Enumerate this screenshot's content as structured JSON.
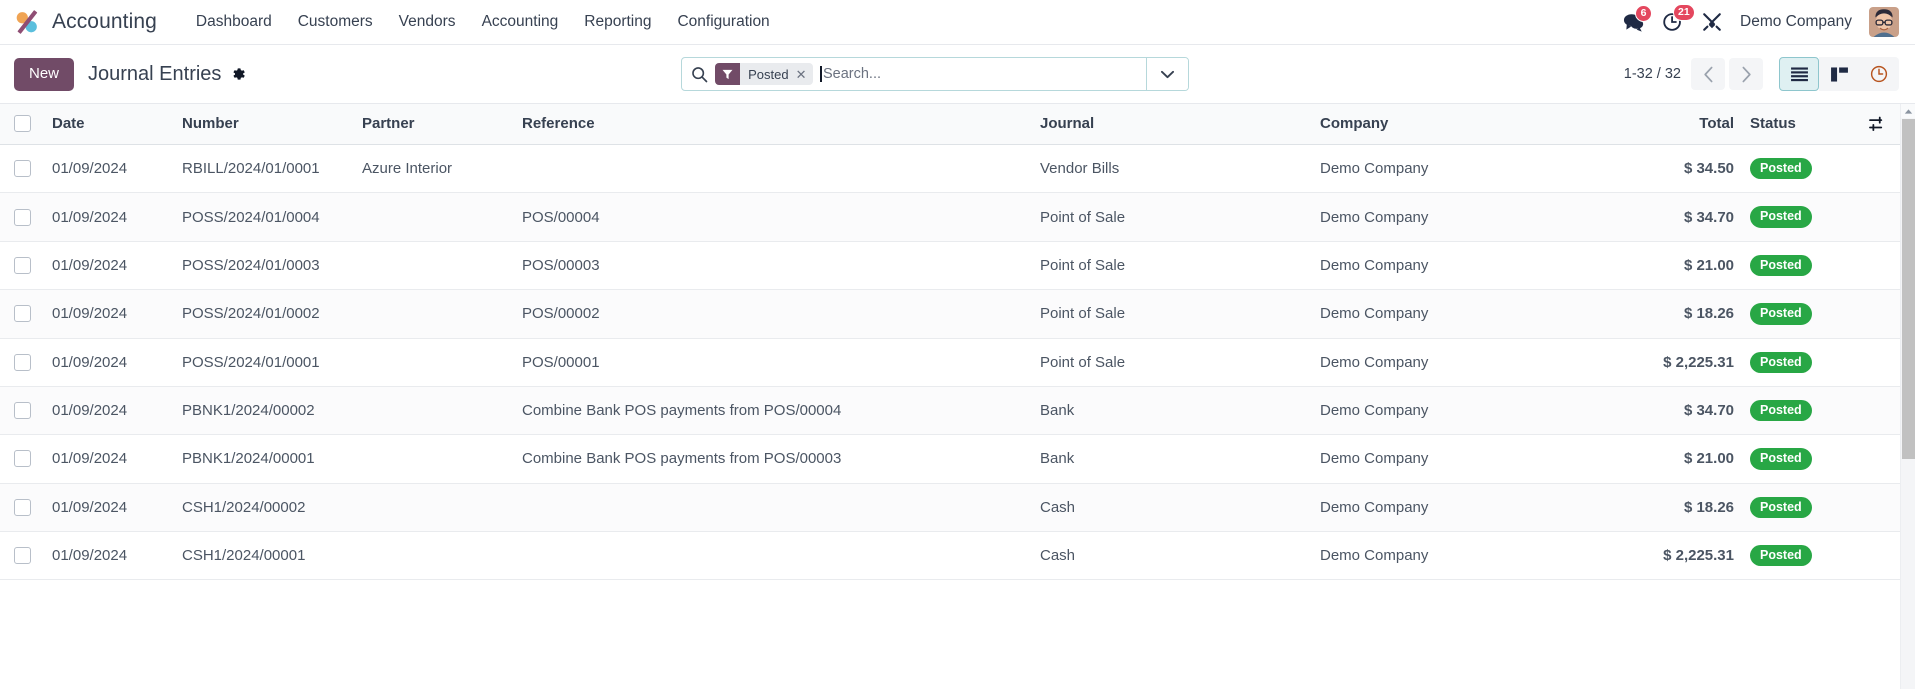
{
  "navbar": {
    "logo_icon": "odoo-logo-icon",
    "app_name": "Accounting",
    "menu": [
      {
        "label": "Dashboard"
      },
      {
        "label": "Customers"
      },
      {
        "label": "Vendors"
      },
      {
        "label": "Accounting"
      },
      {
        "label": "Reporting"
      },
      {
        "label": "Configuration"
      }
    ],
    "systray": {
      "messages_icon": "chat-bubbles-icon",
      "messages_count": "6",
      "activities_icon": "clock-icon",
      "activities_count": "21",
      "debug_icon": "wrench-screwdriver-icon",
      "company": "Demo Company",
      "avatar_icon": "user-avatar-icon"
    }
  },
  "control_panel": {
    "new_label": "New",
    "breadcrumb_title": "Journal Entries",
    "settings_icon": "gear-icon",
    "search": {
      "search_icon": "search-icon",
      "facet_icon": "filter-funnel-icon",
      "facet_label": "Posted",
      "facet_remove_icon": "close-icon",
      "placeholder": "Search...",
      "value": "",
      "dropdown_icon": "caret-down-icon"
    },
    "pager": {
      "value": "1-32 / 32",
      "prev_icon": "chevron-left-icon",
      "next_icon": "chevron-right-icon"
    },
    "views": [
      {
        "name": "list",
        "icon": "list-view-icon",
        "active": true
      },
      {
        "name": "kanban",
        "icon": "kanban-view-icon",
        "active": false
      },
      {
        "name": "activity",
        "icon": "activity-clock-view-icon",
        "active": false
      }
    ]
  },
  "list": {
    "columns": [
      {
        "key": "date",
        "label": "Date"
      },
      {
        "key": "number",
        "label": "Number"
      },
      {
        "key": "partner",
        "label": "Partner"
      },
      {
        "key": "reference",
        "label": "Reference"
      },
      {
        "key": "journal",
        "label": "Journal"
      },
      {
        "key": "company",
        "label": "Company"
      },
      {
        "key": "total",
        "label": "Total"
      },
      {
        "key": "status",
        "label": "Status"
      }
    ],
    "optional_columns_icon": "sliders-icon",
    "select_all_icon": "checkbox-icon",
    "rows": [
      {
        "date": "01/09/2024",
        "number": "RBILL/2024/01/0001",
        "partner": "Azure Interior",
        "reference": "",
        "journal": "Vendor Bills",
        "company": "Demo Company",
        "total": "$ 34.50",
        "status": "Posted"
      },
      {
        "date": "01/09/2024",
        "number": "POSS/2024/01/0004",
        "partner": "",
        "reference": "POS/00004",
        "journal": "Point of Sale",
        "company": "Demo Company",
        "total": "$ 34.70",
        "status": "Posted"
      },
      {
        "date": "01/09/2024",
        "number": "POSS/2024/01/0003",
        "partner": "",
        "reference": "POS/00003",
        "journal": "Point of Sale",
        "company": "Demo Company",
        "total": "$ 21.00",
        "status": "Posted"
      },
      {
        "date": "01/09/2024",
        "number": "POSS/2024/01/0002",
        "partner": "",
        "reference": "POS/00002",
        "journal": "Point of Sale",
        "company": "Demo Company",
        "total": "$ 18.26",
        "status": "Posted"
      },
      {
        "date": "01/09/2024",
        "number": "POSS/2024/01/0001",
        "partner": "",
        "reference": "POS/00001",
        "journal": "Point of Sale",
        "company": "Demo Company",
        "total": "$ 2,225.31",
        "status": "Posted"
      },
      {
        "date": "01/09/2024",
        "number": "PBNK1/2024/00002",
        "partner": "",
        "reference": "Combine Bank POS payments from POS/00004",
        "journal": "Bank",
        "company": "Demo Company",
        "total": "$ 34.70",
        "status": "Posted"
      },
      {
        "date": "01/09/2024",
        "number": "PBNK1/2024/00001",
        "partner": "",
        "reference": "Combine Bank POS payments from POS/00003",
        "journal": "Bank",
        "company": "Demo Company",
        "total": "$ 21.00",
        "status": "Posted"
      },
      {
        "date": "01/09/2024",
        "number": "CSH1/2024/00002",
        "partner": "",
        "reference": "",
        "journal": "Cash",
        "company": "Demo Company",
        "total": "$ 18.26",
        "status": "Posted"
      },
      {
        "date": "01/09/2024",
        "number": "CSH1/2024/00001",
        "partner": "",
        "reference": "",
        "journal": "Cash",
        "company": "Demo Company",
        "total": "$ 2,225.31",
        "status": "Posted"
      }
    ]
  },
  "colors": {
    "brand_purple": "#714B67",
    "badge_green": "#28A745",
    "badge_red": "#E4475E",
    "active_view_bg": "#DFF0F2",
    "text": "#374151"
  }
}
